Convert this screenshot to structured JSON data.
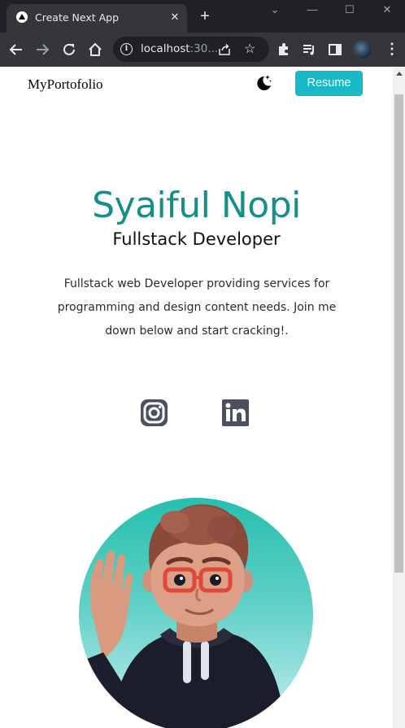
{
  "browser": {
    "tab_title": "Create Next App",
    "tab_close": "✕",
    "new_tab": "+",
    "window_controls": [
      "⌄",
      "—",
      "☐",
      "✕"
    ],
    "url_host": "localhost",
    "url_rest": ":30...",
    "icons": [
      "back-arrow-icon",
      "forward-arrow-icon",
      "reload-icon",
      "home-icon",
      "info-icon",
      "share-icon",
      "star-icon",
      "extensions-icon",
      "media-icon",
      "side-panel-icon",
      "profile-avatar-icon",
      "kebab-menu-icon"
    ]
  },
  "navbar": {
    "logo": "MyPortofolio",
    "theme_icon": "moon-stars-icon",
    "resume_label": "Resume"
  },
  "hero": {
    "name": "Syaiful Nopi",
    "role": "Fullstack Developer",
    "description": "Fullstack web Developer providing services for programming and design content needs. Join me down below and start cracking!."
  },
  "social": [
    "instagram-icon",
    "linkedin-icon"
  ],
  "colors": {
    "accent": "#178f86",
    "button": "#18b9c6",
    "social_icon": "#4a5060"
  }
}
